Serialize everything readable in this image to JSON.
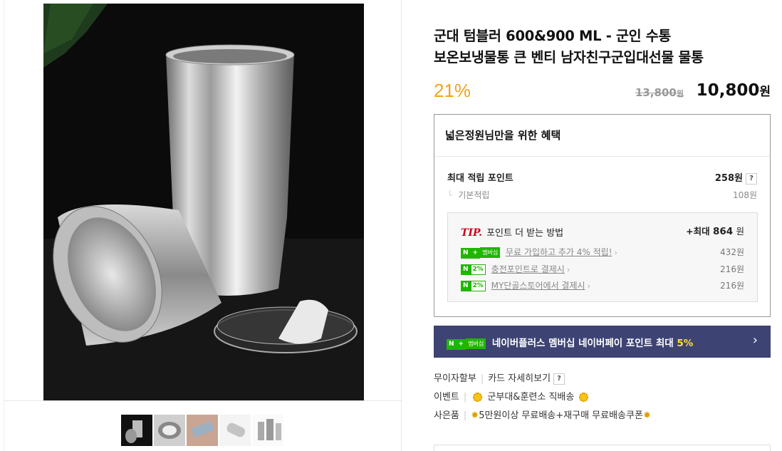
{
  "product": {
    "title_line1": "군대 텀블러 600&900 ML - 군인 수통",
    "title_line2": "보온보냉물통 큰 벤티 남자친구군입대선물 물통",
    "discount": "21%",
    "original_price": "13,800",
    "original_unit": "원",
    "sale_price": "10,800",
    "sale_unit": "원"
  },
  "benefit": {
    "heading": "넓은정원님만을 위한 혜택",
    "max_points_label": "최대 적립 포인트",
    "max_points_value": "258원",
    "basic_label": "기본적립",
    "basic_value": "108원",
    "help": "?",
    "tip": {
      "tip_word": "TIP.",
      "title": "포인트 더 받는 방법",
      "max_prefix": "+최대",
      "max_value": "864",
      "max_unit": "원",
      "rows": [
        {
          "badge_n": "N",
          "badge_plus": "+",
          "badge_text": "멤버십",
          "label": "무료 가입하고 추가 4% 적립!",
          "value": "432원"
        },
        {
          "badge_n": "N",
          "badge_text": "2%",
          "label": "충전포인트로 결제시",
          "value": "216원"
        },
        {
          "badge_n": "N",
          "badge_text": "2%",
          "label": "MY단골스토어에서 결제시",
          "value": "216원"
        }
      ]
    }
  },
  "banner": {
    "badge_n": "N",
    "badge_plus": "+",
    "badge_text": "멤버십",
    "text": "네이버플러스 멤버십 네이버페이 포인트 최대",
    "highlight": "5%",
    "arrow": "›"
  },
  "meta": {
    "installment": "무이자할부",
    "card": "카드 자세히보기",
    "help": "?",
    "event_label": "이벤트",
    "event_text": "군부대&훈련소 직배송",
    "gift_label": "사은품",
    "gift_text": "5만원이상 무료배송+재구매 무료배송쿠폰"
  },
  "colors": {
    "discount": "#f2a31b",
    "banner_bg": "#3d4373",
    "naver_green": "#1fb600",
    "tip_red": "#d3001c"
  }
}
